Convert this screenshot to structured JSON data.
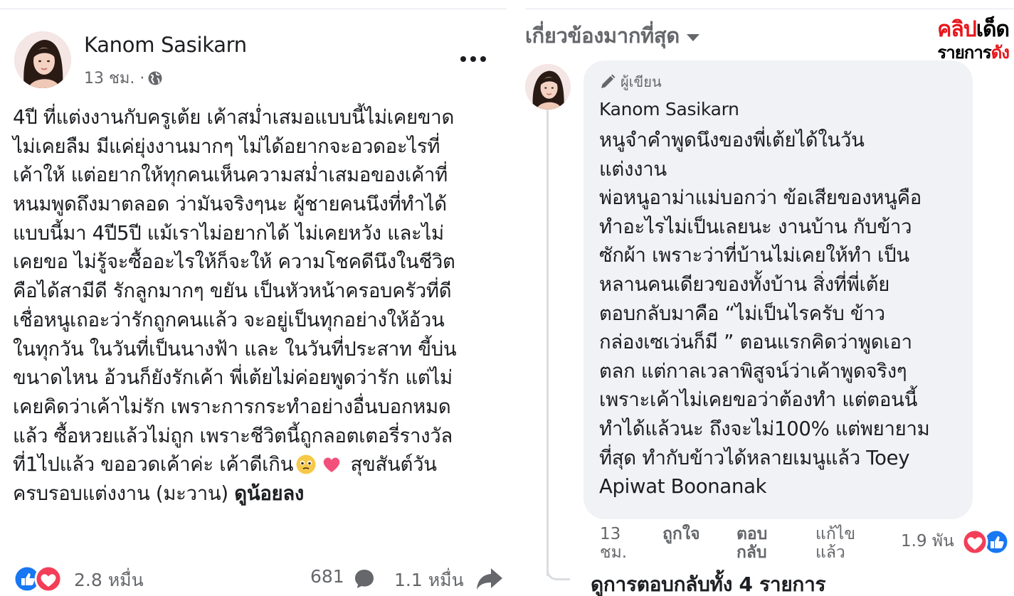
{
  "post": {
    "author": "Kanom Sasikarn",
    "time": "13 ชม. ·",
    "lines": [
      "4ปี ที่แต่งงานกับครูเต้ย เค้าสม่ำเสมอแบบนี้ไม่เคยขาด",
      "ไม่เคยลืม มีแค่ยุ่งงานมากๆ ไม่ได้อยากจะอวดอะไรที่",
      "เค้าให้ แต่อยากให้ทุกคนเห็นความสม่ำเสมอของเค้าที่",
      "หนมพูดถึงมาตลอด ว่ามันจริงๆนะ ผู้ชายคนนึงที่ทำได้",
      "แบบนี้มา 4ปี5ปี แม้เราไม่อยากได้ ไม่เคยหวัง และไม่",
      "เคยขอ ไม่รู้จะซื้ออะไรให้ก็จะให้ ความโชคดีนึงในชีวิต",
      "คือได้สามีดี รักลูกมากๆ ขยัน เป็นหัวหน้าครอบครัวที่ดี",
      "เชื่อหนูเถอะว่ารักถูกคนแล้ว จะอยู่เป็นทุกอย่างให้อ้วน",
      "ในทุกวัน ในวันที่เป็นนางฟ้า และ ในวันที่ประสาท ขี้บ่น",
      "ขนาดไหน อ้วนก็ยังรักเค้า พี่เต้ยไม่ค่อยพูดว่ารัก แต่ไม่",
      "เคยคิดว่าเค้าไม่รัก เพราะการกระทำอย่างอื่นบอกหมด",
      "แล้ว ซื้อหวยแล้วไม่ถูก เพราะชีวิตนี้ถูกลอตเตอรี่รางวัล",
      "ที่1ไปแล้ว ขออวดเค้าค่ะ เค้าดีเกิน"
    ],
    "line13_tail": "สุขสันต์วัน",
    "line14": "ครบรอบแต่งงาน (มะวาน)",
    "see_less": "ดูน้อยลง",
    "reactions": "2.8 หมื่น",
    "comments": "681",
    "shares": "1.1 หมื่น"
  },
  "sidebar": {
    "sort_label": "เกี่ยวข้องมากที่สุด",
    "logo": {
      "part1": "คลิป",
      "part2": "เด็ด",
      "part3": "รายการ",
      "part4": "ดัง"
    }
  },
  "comment": {
    "badge": "ผู้เขียน",
    "author": "Kanom Sasikarn",
    "lines": [
      "หนูจำคำพูดนึงของพี่เต้ยได้ในวัน",
      "แต่งงาน",
      "พ่อหนูอาม่าแม่บอกว่า ข้อเสียของหนูคือ",
      "ทำอะไรไม่เป็นเลยนะ งานบ้าน กับข้าว",
      "ซักผ้า เพราะว่าที่บ้านไม่เคยให้ทำ เป็น",
      "หลานคนเดียวของทั้งบ้าน สิ่งที่พี่เต้ย",
      "ตอบกลับมาคือ “ไม่เป็นไรครับ ข้าว",
      "กล่องเซเว่นก็มี ” ตอนแรกคิดว่าพูดเอา",
      "ตลก แต่กาลเวลาพิสูจน์ว่าเค้าพูดจริงๆ",
      "เพราะเค้าไม่เคยขอว่าต้องทำ แต่ตอนนี้",
      "ทำได้แล้วนะ ถึงจะไม่100% แต่พยายาม",
      "ที่สุด ทำกับข้าวได้หลายเมนูแล้ว Toey",
      "Apiwat Boonanak"
    ],
    "time": "13 ชม.",
    "like": "ถูกใจ",
    "reply": "ตอบ กลับ",
    "edited": "แก้ไข แล้ว",
    "reactions": "1.9 พัน",
    "view_replies": "ดูการตอบกลับทั้ง 4 รายการ"
  },
  "colors": {
    "like_blue": "#1877f2",
    "love_red": "#f33e58",
    "secondary_text": "#65676b",
    "bubble_bg": "#f0f2f5",
    "logo_red": "#e8151b"
  },
  "icons": [
    "globe-icon",
    "more-icon",
    "comment-icon",
    "share-icon",
    "pencil-icon",
    "caret-down-icon",
    "like-icon",
    "love-icon",
    "teary-face-icon",
    "heart-icon"
  ]
}
